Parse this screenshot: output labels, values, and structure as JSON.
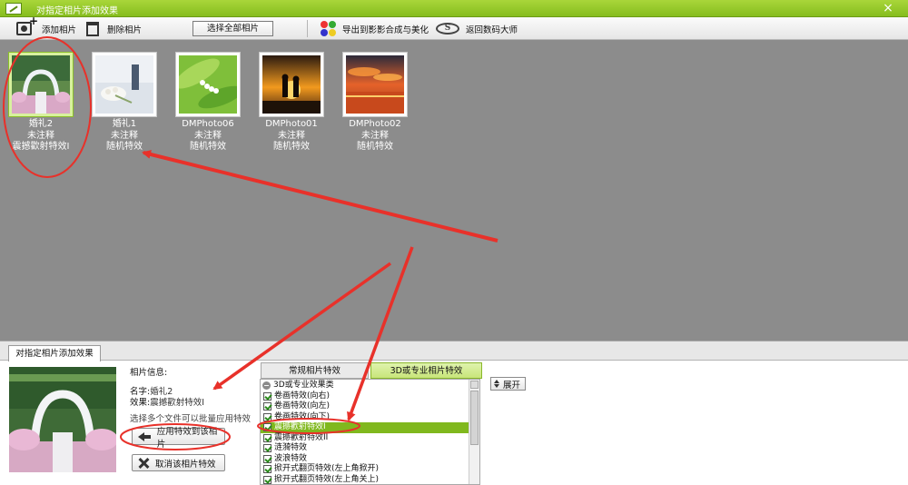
{
  "window": {
    "title": "对指定相片添加效果",
    "close_label": "×"
  },
  "toolbar": {
    "add_label": "添加相片",
    "delete_label": "删除相片",
    "select_all_label": "选择全部相片",
    "export_label": "导出到影影合成与美化",
    "return_label": "返回数码大师",
    "return_icon_text": "S"
  },
  "photos": [
    {
      "name": "婚礼2",
      "note": "未注释",
      "effect": "震撼歡射特效I",
      "selected": true,
      "icon": "wedding-arch-photo"
    },
    {
      "name": "婚礼1",
      "note": "未注释",
      "effect": "随机特效",
      "selected": false,
      "icon": "bouquet-photo"
    },
    {
      "name": "DMPhoto06",
      "note": "未注释",
      "effect": "随机特效",
      "selected": false,
      "icon": "lily-of-the-valley-photo"
    },
    {
      "name": "DMPhoto01",
      "note": "未注释",
      "effect": "随机特效",
      "selected": false,
      "icon": "sunset-silhouette-photo"
    },
    {
      "name": "DMPhoto02",
      "note": "未注释",
      "effect": "随机特效",
      "selected": false,
      "icon": "sunset-sea-photo"
    }
  ],
  "panel": {
    "tab_label": "对指定相片添加效果",
    "info_title": "相片信息:",
    "name_label": "名字:",
    "name_value": "婚礼2",
    "effect_label": "效果:",
    "effect_value": "震撼歡射特效I",
    "batch_hint": "选择多个文件可以批量应用特效",
    "apply_label": "应用特效到该相片",
    "cancel_label": "取消该相片特效",
    "expand_label": "展开"
  },
  "effect_tabs": {
    "normal": "常规相片特效",
    "pro": "3D或专业相片特效",
    "active": "pro"
  },
  "effect_list": {
    "group": "3D或专业效果类",
    "group_expander": "−",
    "items": [
      {
        "label": "卷画特效(向右)",
        "checked": true,
        "selected": false
      },
      {
        "label": "卷画特效(向左)",
        "checked": true,
        "selected": false
      },
      {
        "label": "卷画特效(向下)",
        "checked": true,
        "selected": false
      },
      {
        "label": "震撼歡射特效I",
        "checked": true,
        "selected": true
      },
      {
        "label": "震撼歡射特效II",
        "checked": true,
        "selected": false
      },
      {
        "label": "涟漪特效",
        "checked": true,
        "selected": false
      },
      {
        "label": "波浪特效",
        "checked": true,
        "selected": false
      },
      {
        "label": "掀开式翻页特效(左上角掀开)",
        "checked": true,
        "selected": false
      },
      {
        "label": "掀开式翻页特效(左上角关上)",
        "checked": true,
        "selected": false
      }
    ]
  },
  "annotation_colors": {
    "ellipse": "#e8312a",
    "arrow": "#e8312a"
  }
}
